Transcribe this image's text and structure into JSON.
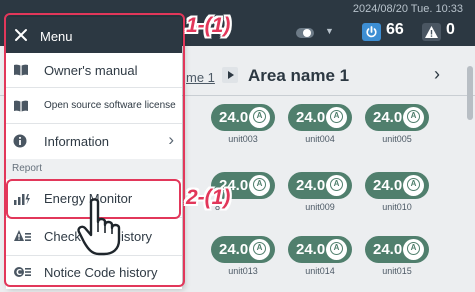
{
  "topbar": {
    "datetime": "2024/08/20 Tue. 10:33",
    "power_count": "66",
    "alert_count": "0",
    "icons": [
      "toggle-icon",
      "caret-down-icon",
      "power-icon",
      "alert-icon"
    ]
  },
  "area": {
    "crumb": "me 1",
    "name": "Area name 1",
    "next": "›"
  },
  "menu": {
    "title": "Menu",
    "items": [
      {
        "label": "Owner's manual",
        "icon": "book-icon"
      },
      {
        "label": "Open source software license",
        "icon": "book-icon"
      },
      {
        "label": "Information",
        "icon": "info-icon",
        "chevron": "›"
      }
    ],
    "section": "Report",
    "report_items": [
      {
        "label": "Energy Monitor",
        "icon": "energy-chart-icon"
      },
      {
        "label": "Check",
        "label_tail": "istory",
        "icon": "check-history-icon"
      },
      {
        "label": "Notice Code history",
        "icon": "notice-code-icon"
      }
    ]
  },
  "units": [
    {
      "temp": "24.0",
      "label": "unit003"
    },
    {
      "temp": "24.0",
      "label": "unit004"
    },
    {
      "temp": "24.0",
      "label": "unit005"
    },
    {
      "temp": "24.0",
      "label": "8"
    },
    {
      "temp": "24.0",
      "label": "unit009"
    },
    {
      "temp": "24.0",
      "label": "unit010"
    },
    {
      "temp": "24.0",
      "label": "unit013"
    },
    {
      "temp": "24.0",
      "label": "unit014"
    },
    {
      "temp": "24.0",
      "label": "unit015"
    }
  ],
  "unit_mode_letter": "A",
  "annotations": {
    "step1": "1-(1)",
    "step2": "2-(1)"
  },
  "colors": {
    "topbar": "#2c3842",
    "unit_green": "#507f6d",
    "power_blue": "#3d8ed3",
    "annotation_red": "#e2375a"
  }
}
